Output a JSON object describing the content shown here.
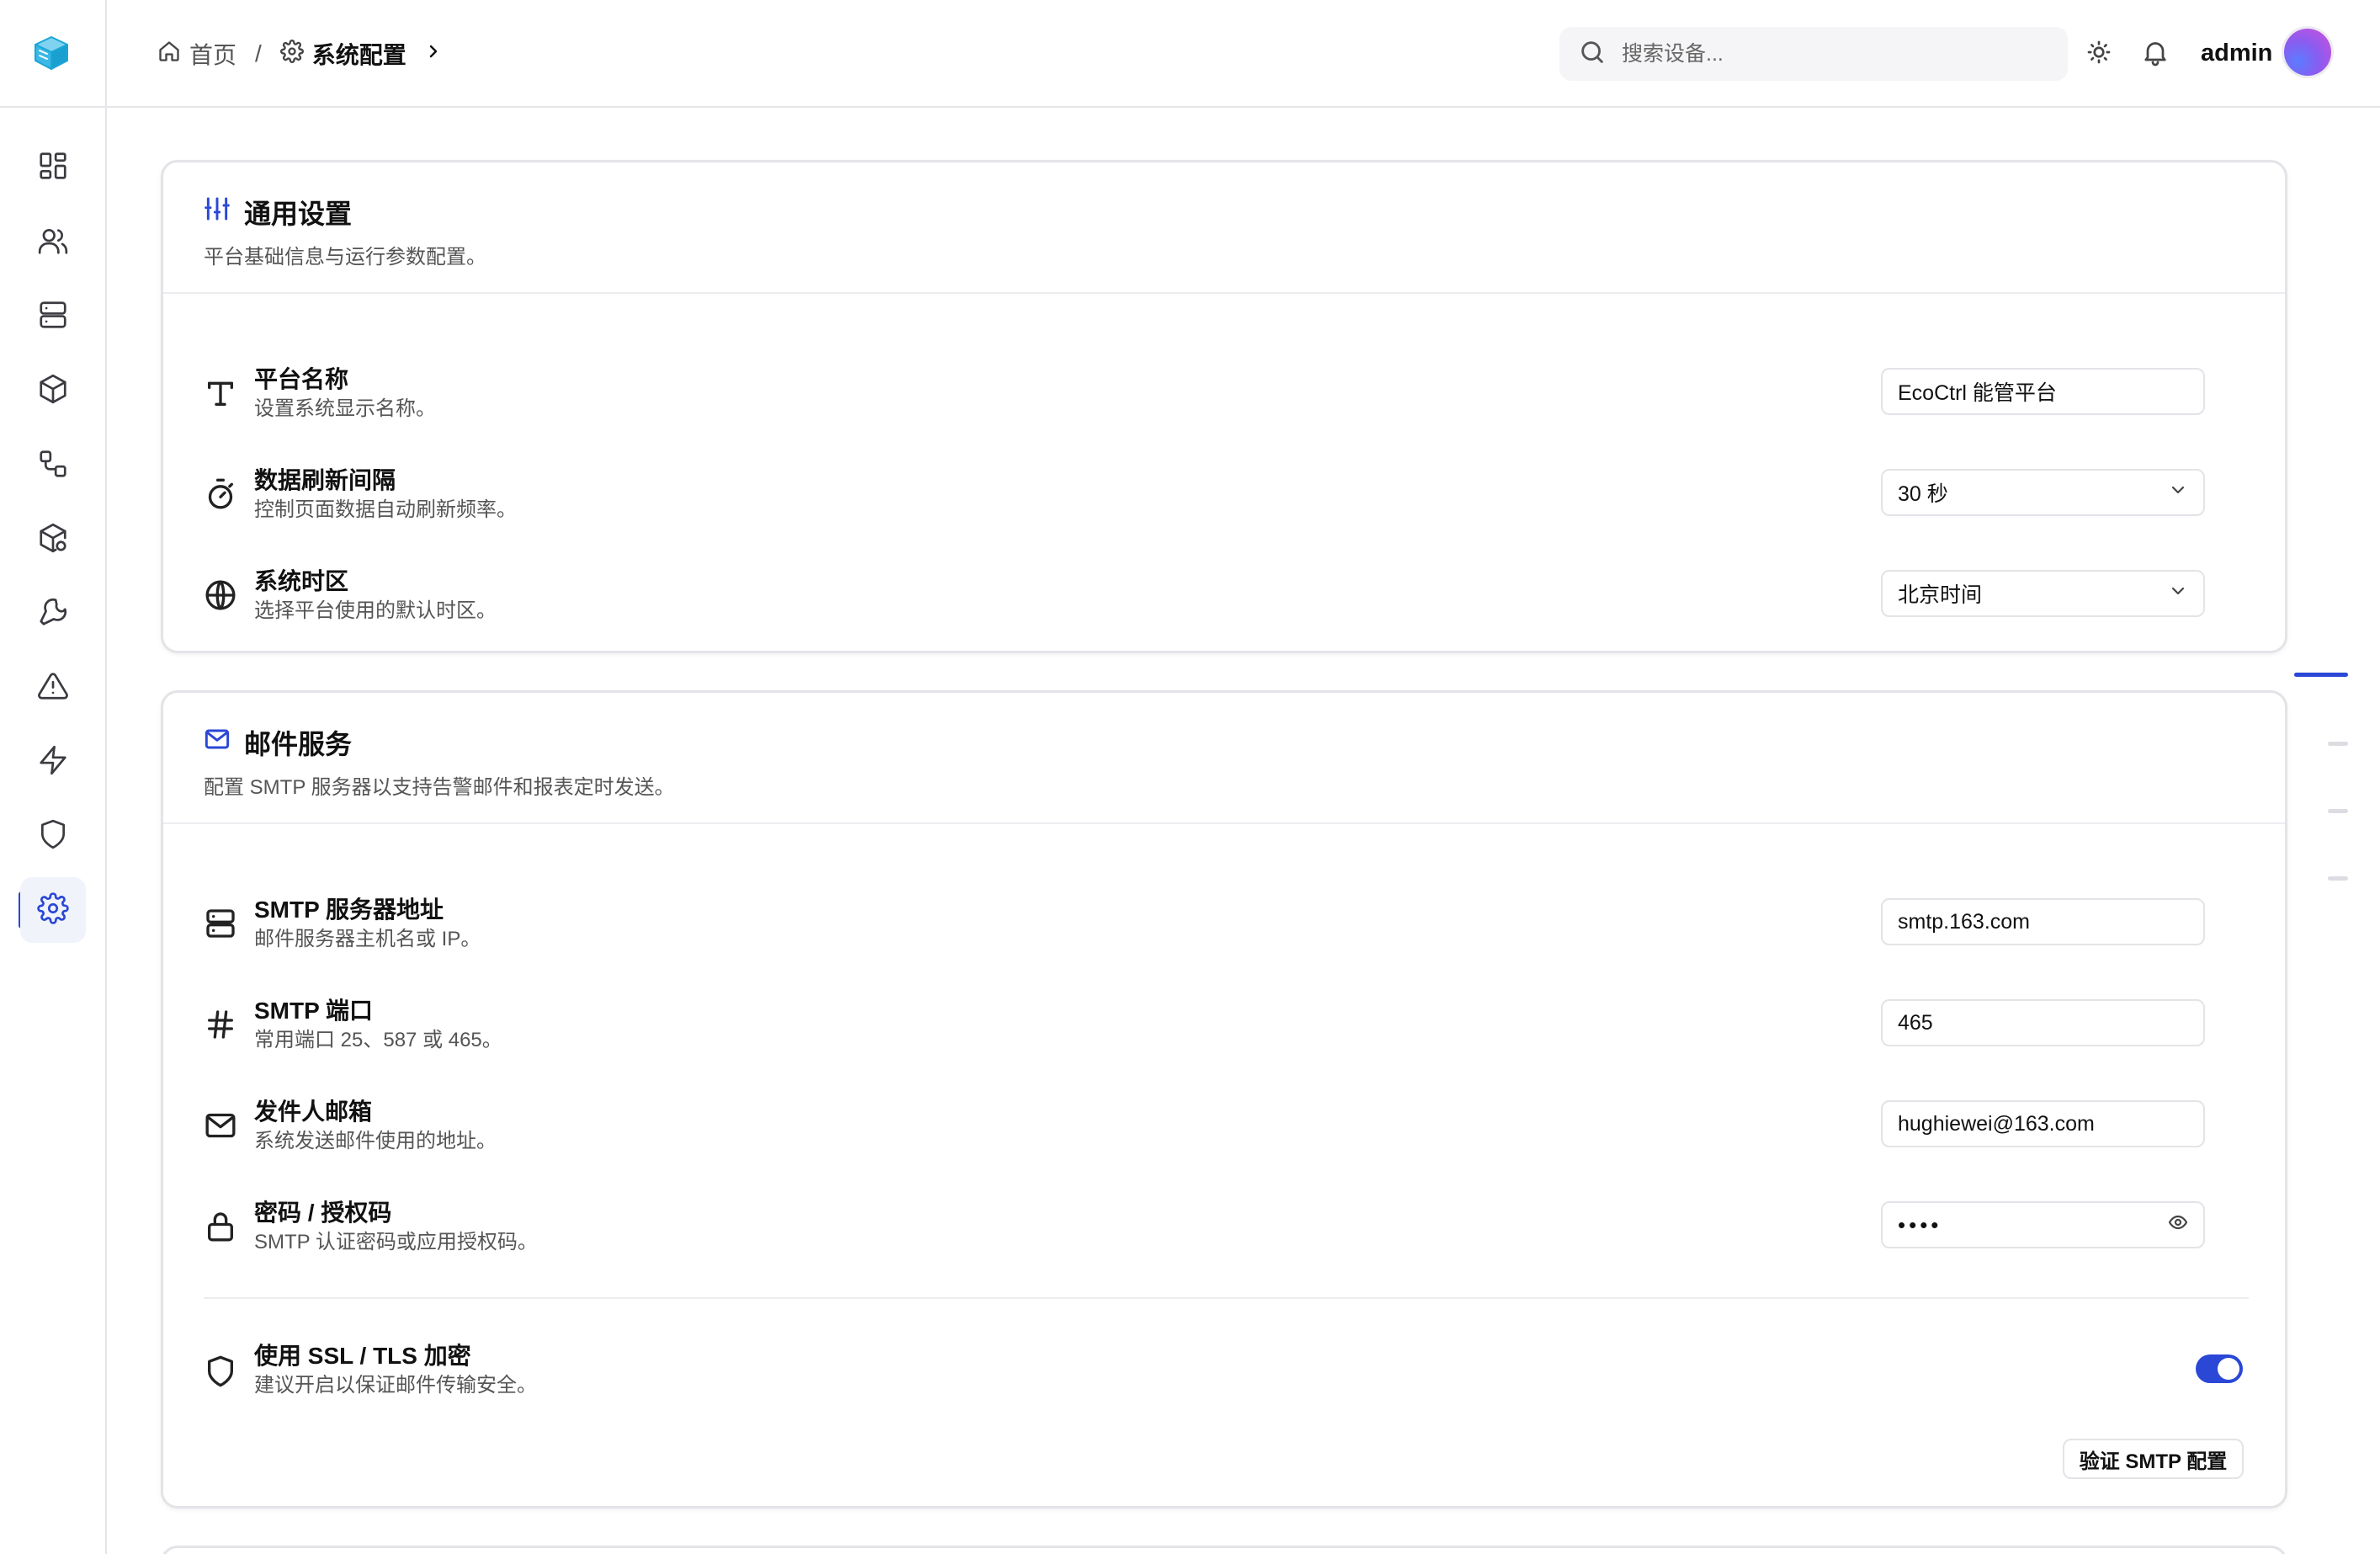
{
  "header": {
    "breadcrumb": {
      "home": "首页",
      "separator": "/",
      "current": "系统配置"
    },
    "search": {
      "placeholder": "搜索设备..."
    },
    "username": "admin"
  },
  "sidebar": {
    "items": [
      {
        "name": "dashboard",
        "icon": "grid-icon"
      },
      {
        "name": "users",
        "icon": "users-icon"
      },
      {
        "name": "servers",
        "icon": "server-icon"
      },
      {
        "name": "devices",
        "icon": "box-icon"
      },
      {
        "name": "workflow",
        "icon": "workflow-icon"
      },
      {
        "name": "packages",
        "icon": "box-settings-icon"
      },
      {
        "name": "maintenance",
        "icon": "wrench-icon"
      },
      {
        "name": "alarms",
        "icon": "alert-triangle-icon"
      },
      {
        "name": "energy",
        "icon": "zap-icon"
      },
      {
        "name": "security",
        "icon": "shield-icon"
      },
      {
        "name": "settings",
        "icon": "gear-icon",
        "active": true
      }
    ],
    "accent": "#2a47d6"
  },
  "general": {
    "title": "通用设置",
    "description": "平台基础信息与运行参数配置。",
    "platform_name": {
      "label": "平台名称",
      "help": "设置系统显示名称。",
      "value": "EcoCtrl 能管平台"
    },
    "refresh_interval": {
      "label": "数据刷新间隔",
      "help": "控制页面数据自动刷新频率。",
      "value": "30 秒"
    },
    "timezone": {
      "label": "系统时区",
      "help": "选择平台使用的默认时区。",
      "value": "北京时间"
    }
  },
  "mail": {
    "title": "邮件服务",
    "description": "配置 SMTP 服务器以支持告警邮件和报表定时发送。",
    "smtp_host": {
      "label": "SMTP 服务器地址",
      "help": "邮件服务器主机名或 IP。",
      "value": "smtp.163.com"
    },
    "smtp_port": {
      "label": "SMTP 端口",
      "help": "常用端口 25、587 或 465。",
      "value": "465"
    },
    "sender": {
      "label": "发件人邮箱",
      "help": "系统发送邮件使用的地址。",
      "value": "hughiewei@163.com"
    },
    "password": {
      "label": "密码 / 授权码",
      "help": "SMTP 认证密码或应用授权码。",
      "value": "••••"
    },
    "ssl": {
      "label": "使用 SSL / TLS 加密",
      "help": "建议开启以保证邮件传输安全。",
      "enabled": true
    },
    "verify_button": "验证 SMTP 配置"
  }
}
